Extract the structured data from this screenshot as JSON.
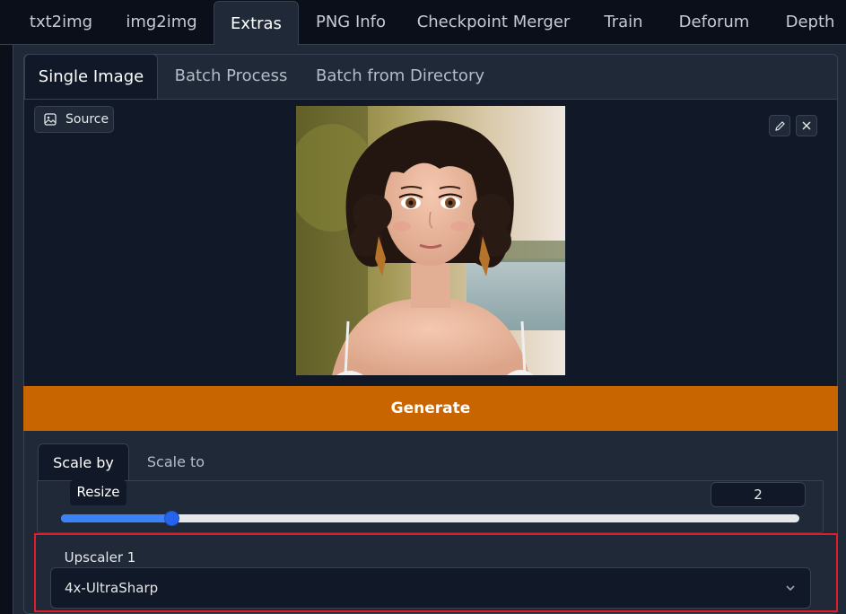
{
  "top_tabs": [
    "txt2img",
    "img2img",
    "Extras",
    "PNG Info",
    "Checkpoint Merger",
    "Train",
    "Deforum",
    "Depth"
  ],
  "active_top_tab": "Extras",
  "sub_tabs": [
    "Single Image",
    "Batch Process",
    "Batch from Directory"
  ],
  "active_sub_tab": "Single Image",
  "image": {
    "source_label": "Source",
    "icons": [
      "image-icon",
      "pencil-icon",
      "close-icon"
    ]
  },
  "generate_label": "Generate",
  "scale_tabs": [
    "Scale by",
    "Scale to"
  ],
  "active_scale_tab": "Scale by",
  "resize": {
    "label": "Resize",
    "value": "2",
    "slider_fraction": 0.15
  },
  "upscaler": {
    "label": "Upscaler 1",
    "value": "4x-UltraSharp"
  },
  "colors": {
    "generate": "#c96500",
    "slider": "#3b82f6",
    "highlight": "#e11d2a",
    "background": "#0b0f19"
  }
}
